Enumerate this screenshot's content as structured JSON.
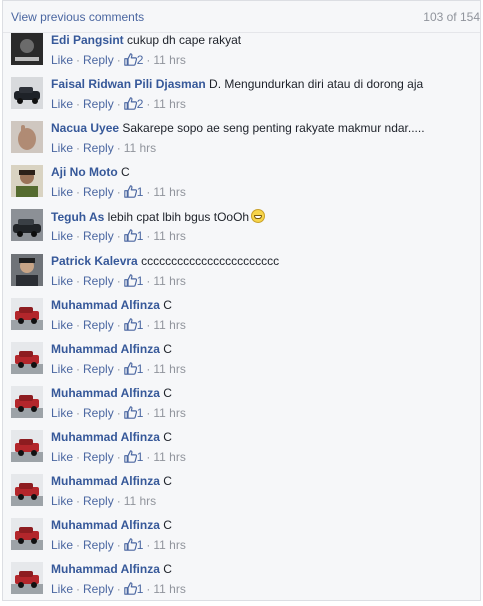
{
  "header": {
    "view_previous": "View previous comments",
    "count": "103 of 154"
  },
  "actions": {
    "like": "Like",
    "reply": "Reply"
  },
  "comments": [
    {
      "author": "Edi Pangsint",
      "text": " cukup dh cape rakyat",
      "likes": "2",
      "time": "11 hrs",
      "avatar": "avatar-dark-poster"
    },
    {
      "author": "Faisal Ridwan Pili Djasman",
      "text": " D. Mengundurkan diri atau di dorong aja",
      "likes": "2",
      "time": "11 hrs",
      "avatar": "avatar-car"
    },
    {
      "author": "Nacua Uyee",
      "text": " Sakarepe sopo ae seng penting rakyate makmur ndar.....",
      "likes": "",
      "time": "11 hrs",
      "avatar": "avatar-hand"
    },
    {
      "author": "Aji No Moto",
      "text": " C",
      "likes": "1",
      "time": "11 hrs",
      "avatar": "avatar-man"
    },
    {
      "author": "Teguh As",
      "text": " lebih cpat lbih bgus tOoOh",
      "emoji": "grin-emoji",
      "likes": "1",
      "time": "11 hrs",
      "avatar": "avatar-car-dark"
    },
    {
      "author": "Patrick Kalevra",
      "text": " ccccccccccccccccccccccc",
      "likes": "1",
      "time": "11 hrs",
      "avatar": "avatar-man-dark"
    },
    {
      "author": "Muhammad Alfinza",
      "text": " C",
      "likes": "1",
      "time": "11 hrs",
      "avatar": "avatar-red-car"
    },
    {
      "author": "Muhammad Alfinza",
      "text": " C",
      "likes": "1",
      "time": "11 hrs",
      "avatar": "avatar-red-car"
    },
    {
      "author": "Muhammad Alfinza",
      "text": " C",
      "likes": "1",
      "time": "11 hrs",
      "avatar": "avatar-red-car"
    },
    {
      "author": "Muhammad Alfinza",
      "text": " C",
      "likes": "1",
      "time": "11 hrs",
      "avatar": "avatar-red-car"
    },
    {
      "author": "Muhammad Alfinza",
      "text": " C",
      "likes": "",
      "time": "11 hrs",
      "avatar": "avatar-red-car"
    },
    {
      "author": "Muhammad Alfinza",
      "text": " C",
      "likes": "1",
      "time": "11 hrs",
      "avatar": "avatar-red-car"
    },
    {
      "author": "Muhammad Alfinza",
      "text": " C",
      "likes": "1",
      "time": "11 hrs",
      "avatar": "avatar-red-car"
    }
  ]
}
